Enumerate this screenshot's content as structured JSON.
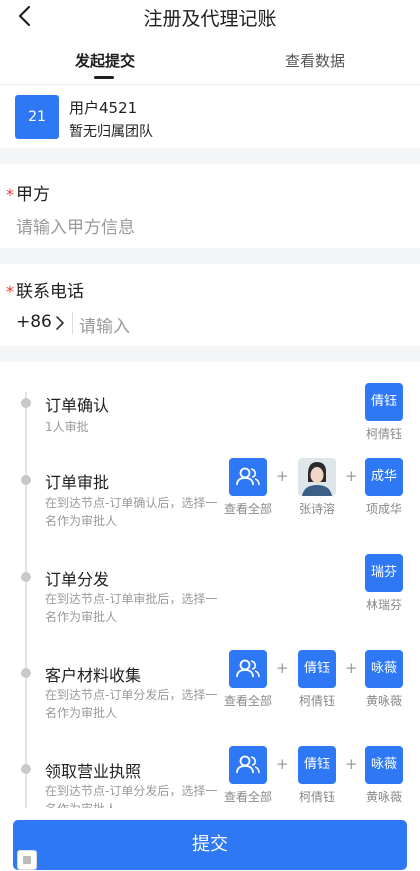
{
  "nav": {
    "title": "注册及代理记账"
  },
  "tabs": [
    {
      "label": "发起提交",
      "active": true
    },
    {
      "label": "查看数据",
      "active": false
    }
  ],
  "user": {
    "avatar_text": "21",
    "name": "用户4521",
    "team": "暂无归属团队"
  },
  "form": {
    "party_a": {
      "required_mark": "*",
      "label": "甲方",
      "placeholder": "请输入甲方信息"
    },
    "phone": {
      "required_mark": "*",
      "label": "联系电话",
      "country_code": "+86",
      "placeholder": "请输入"
    }
  },
  "flow": {
    "steps": [
      {
        "title": "订单确认",
        "desc": "1人审批",
        "approvers": [
          {
            "box": "倩钰",
            "name": "柯倩钰"
          }
        ]
      },
      {
        "title": "订单审批",
        "desc": "在到达节点-订单确认后，选择一名作为审批人",
        "approvers": [
          {
            "icon": "group-icon",
            "name": "查看全部"
          },
          {
            "photo": "user-photo",
            "name": "张诗溶"
          },
          {
            "box": "成华",
            "name": "项成华"
          }
        ]
      },
      {
        "title": "订单分发",
        "desc": "在到达节点-订单审批后，选择一名作为审批人",
        "approvers": [
          {
            "box": "瑞芬",
            "name": "林瑞芬"
          }
        ]
      },
      {
        "title": "客户材料收集",
        "desc": "在到达节点-订单分发后，选择一名作为审批人",
        "approvers": [
          {
            "icon": "group-icon",
            "name": "查看全部"
          },
          {
            "box": "倩钰",
            "name": "柯倩钰"
          },
          {
            "box": "咏薇",
            "name": "黄咏薇"
          }
        ]
      },
      {
        "title": "领取营业执照",
        "desc": "在到达节点-订单分发后，选择一名作为审批人",
        "approvers": [
          {
            "icon": "group-icon",
            "name": "查看全部"
          },
          {
            "box": "倩钰",
            "name": "柯倩钰"
          },
          {
            "box": "咏薇",
            "name": "黄咏薇"
          }
        ]
      }
    ],
    "plus": "+"
  },
  "submit": {
    "label": "提交"
  },
  "colors": {
    "accent": "#2e78f5",
    "required": "#e53935"
  }
}
